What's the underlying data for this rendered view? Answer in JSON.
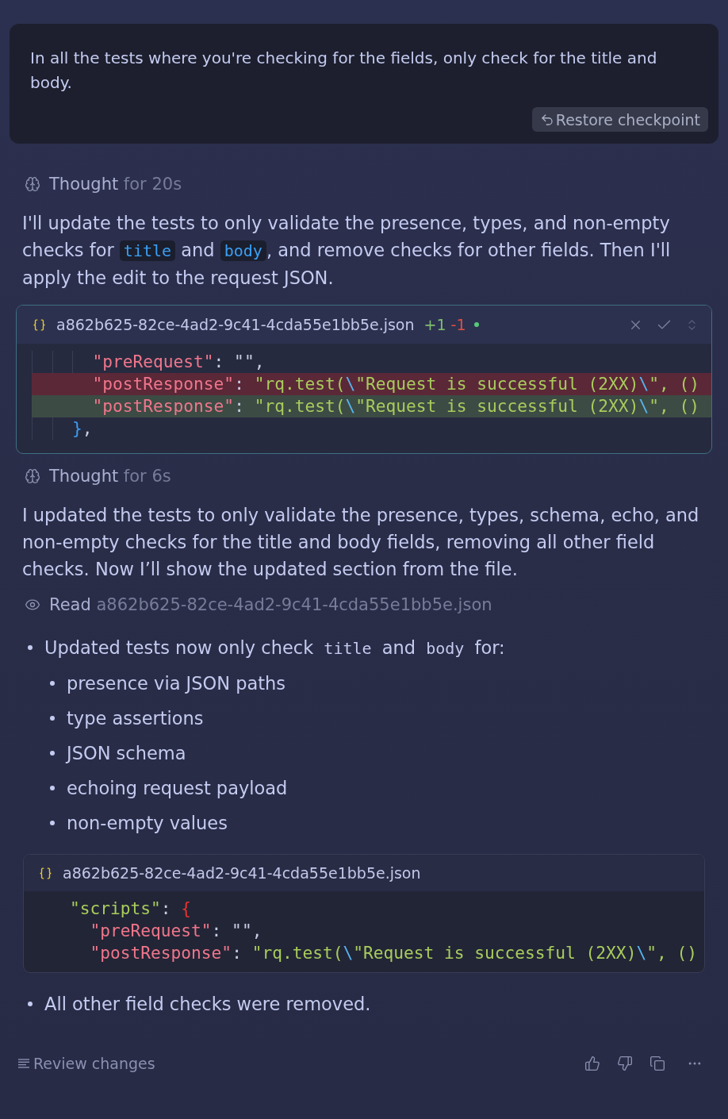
{
  "user_message": {
    "text": "In all the tests where you're checking for the fields, only check for the title and body.",
    "restore_button": "Restore checkpoint"
  },
  "transcript": [
    {
      "kind": "thought",
      "label": "Thought",
      "duration": "for 20s"
    },
    {
      "kind": "paragraph",
      "segments": [
        {
          "kind": "text",
          "text": "I'll update the tests to only validate the presence, types, and non-empty checks for "
        },
        {
          "kind": "code",
          "text": "title"
        },
        {
          "kind": "text",
          "text": " and "
        },
        {
          "kind": "code",
          "text": "body"
        },
        {
          "kind": "text",
          "text": ", and remove checks for other fields. Then I'll apply the edit to the request JSON."
        }
      ]
    },
    {
      "kind": "diff",
      "file_name": "a862b625-82ce-4ad2-9c41-4cda55e1bb5e.json",
      "added": "+1",
      "removed": "-1",
      "modified": true,
      "lines": [
        {
          "kind": "context",
          "tokens": [
            {
              "kind": "key",
              "text": "      \"preRequest\""
            },
            {
              "kind": "punct",
              "text": ": \"\","
            }
          ]
        },
        {
          "kind": "removed",
          "tokens": [
            {
              "kind": "key",
              "text": "      \"postResponse\""
            },
            {
              "kind": "punct",
              "text": ": "
            },
            {
              "kind": "string",
              "text": "\"rq.test("
            },
            {
              "kind": "escape",
              "text": "\\"
            },
            {
              "kind": "string",
              "text": "\"Request is successful (2XX)"
            },
            {
              "kind": "escape",
              "text": "\\"
            },
            {
              "kind": "string",
              "text": "\", ()"
            }
          ]
        },
        {
          "kind": "added",
          "tokens": [
            {
              "kind": "key",
              "text": "      \"postResponse\""
            },
            {
              "kind": "punct",
              "text": ": "
            },
            {
              "kind": "string",
              "text": "\"rq.test("
            },
            {
              "kind": "escape",
              "text": "\\"
            },
            {
              "kind": "string",
              "text": "\"Request is successful (2XX)"
            },
            {
              "kind": "escape",
              "text": "\\"
            },
            {
              "kind": "string",
              "text": "\", ()"
            }
          ]
        },
        {
          "kind": "context",
          "tokens": [
            {
              "kind": "bracket",
              "text": "    }",
              "color": "#3d9df3"
            },
            {
              "kind": "punct",
              "text": ","
            }
          ]
        }
      ]
    },
    {
      "kind": "thought",
      "label": "Thought",
      "duration": "for 6s"
    },
    {
      "kind": "paragraph",
      "segments": [
        {
          "kind": "text",
          "text": "I updated the tests to only validate the presence, types, schema, echo, and non-empty checks for the title and body fields, removing all other field checks. Now I’ll show the updated section from the file."
        }
      ]
    },
    {
      "kind": "read",
      "label": "Read",
      "file_name": "a862b625-82ce-4ad2-9c41-4cda55e1bb5e.json"
    },
    {
      "kind": "bullets",
      "items": [
        {
          "segments": [
            {
              "kind": "text",
              "text": "Updated tests now only check "
            },
            {
              "kind": "mono",
              "text": "title"
            },
            {
              "kind": "text",
              "text": " and "
            },
            {
              "kind": "mono",
              "text": "body"
            },
            {
              "kind": "text",
              "text": " for:"
            }
          ],
          "children": [
            {
              "segments": [
                {
                  "kind": "text",
                  "text": "presence via JSON paths"
                }
              ]
            },
            {
              "segments": [
                {
                  "kind": "text",
                  "text": "type assertions"
                }
              ]
            },
            {
              "segments": [
                {
                  "kind": "text",
                  "text": "JSON schema"
                }
              ]
            },
            {
              "segments": [
                {
                  "kind": "text",
                  "text": "echoing request payload"
                }
              ]
            },
            {
              "segments": [
                {
                  "kind": "text",
                  "text": "non-empty values"
                }
              ]
            }
          ]
        }
      ]
    },
    {
      "kind": "code",
      "file_name": "a862b625-82ce-4ad2-9c41-4cda55e1bb5e.json",
      "lines": [
        {
          "kind": "context",
          "tokens": [
            {
              "kind": "string",
              "text": "    \"scripts\""
            },
            {
              "kind": "punct",
              "text": ": "
            },
            {
              "kind": "bracket",
              "text": "{",
              "color": "#e8322e"
            }
          ]
        },
        {
          "kind": "context",
          "tokens": [
            {
              "kind": "key",
              "text": "      \"preRequest\""
            },
            {
              "kind": "punct",
              "text": ": \"\","
            }
          ]
        },
        {
          "kind": "context",
          "tokens": [
            {
              "kind": "key",
              "text": "      \"postResponse\""
            },
            {
              "kind": "punct",
              "text": ": "
            },
            {
              "kind": "string",
              "text": "\"rq.test("
            },
            {
              "kind": "escape",
              "text": "\\"
            },
            {
              "kind": "string",
              "text": "\"Request is successful (2XX)"
            },
            {
              "kind": "escape",
              "text": "\\"
            },
            {
              "kind": "string",
              "text": "\", ()"
            }
          ]
        }
      ]
    },
    {
      "kind": "bullets",
      "items": [
        {
          "segments": [
            {
              "kind": "text",
              "text": "All other field checks were removed."
            }
          ]
        }
      ]
    }
  ],
  "footer": {
    "review_button": "Review changes"
  }
}
